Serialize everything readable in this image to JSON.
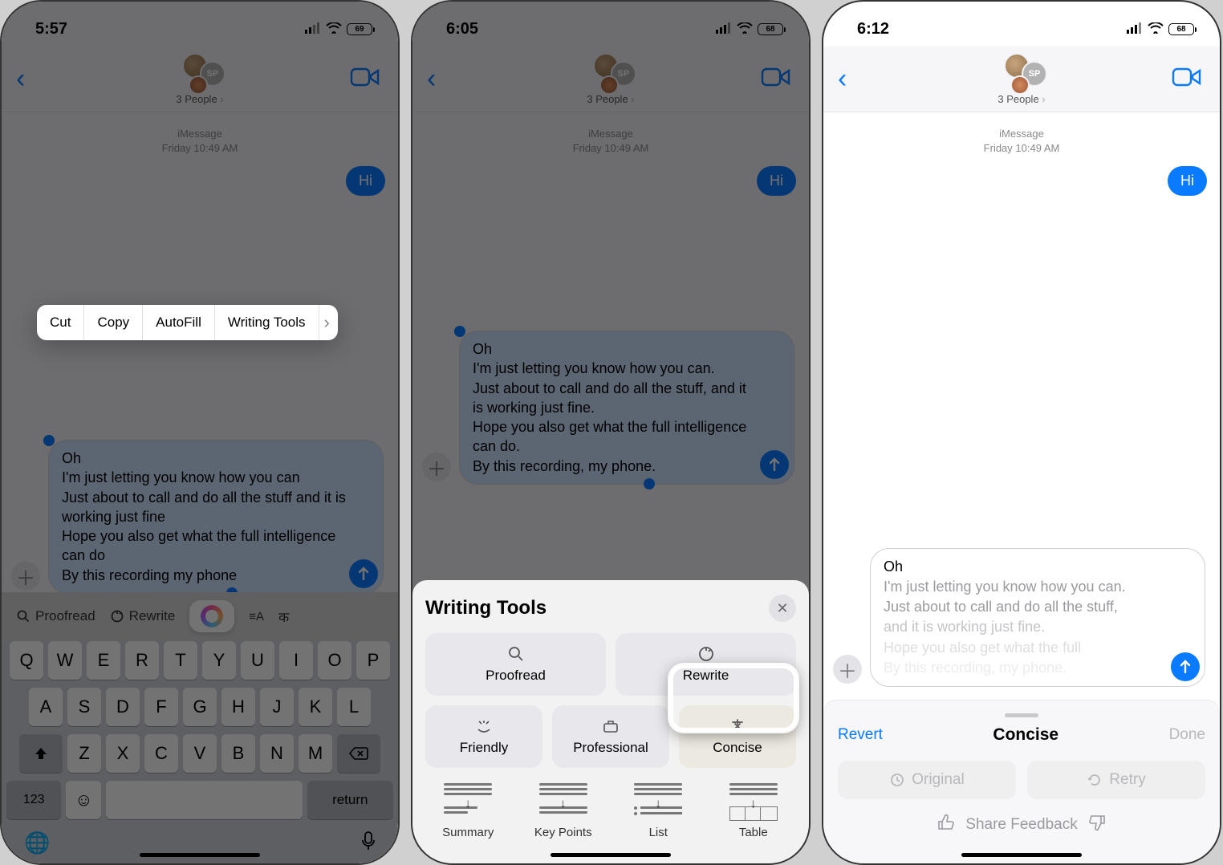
{
  "screens": [
    {
      "status": {
        "time": "5:57",
        "battery": "69"
      },
      "header": {
        "people_label": "3 People",
        "avatar_badge": "SP"
      },
      "thread": {
        "service": "iMessage",
        "timestamp": "Friday 10:49 AM",
        "out_msg": "Hi"
      },
      "compose_text": "Oh\nI'm just letting you know how you can\nJust about to call and do all the stuff and it is working just fine\nHope you also get what the full intelligence can do\nBy this recording my phone",
      "context_menu": {
        "cut": "Cut",
        "copy": "Copy",
        "autofill": "AutoFill",
        "writing_tools": "Writing Tools"
      },
      "quickrow": {
        "proofread": "Proofread",
        "rewrite": "Rewrite"
      },
      "keyboard": {
        "row1": [
          "Q",
          "W",
          "E",
          "R",
          "T",
          "Y",
          "U",
          "I",
          "O",
          "P"
        ],
        "row2": [
          "A",
          "S",
          "D",
          "F",
          "G",
          "H",
          "J",
          "K",
          "L"
        ],
        "row3": [
          "Z",
          "X",
          "C",
          "V",
          "B",
          "N",
          "M"
        ],
        "numkey": "123",
        "return": "return"
      }
    },
    {
      "status": {
        "time": "6:05",
        "battery": "68"
      },
      "header": {
        "people_label": "3 People",
        "avatar_badge": "SP"
      },
      "thread": {
        "service": "iMessage",
        "timestamp": "Friday 10:49 AM",
        "out_msg": "Hi"
      },
      "compose_text": "Oh\nI'm just letting you know how you can.\nJust about to call and do all the stuff, and it is working just fine.\nHope you also get what the full intelligence can do.\nBy this recording, my phone.",
      "wt_panel": {
        "title": "Writing Tools",
        "proofread": "Proofread",
        "rewrite": "Rewrite",
        "friendly": "Friendly",
        "professional": "Professional",
        "concise": "Concise",
        "summary": "Summary",
        "keypoints": "Key Points",
        "list": "List",
        "table": "Table"
      }
    },
    {
      "status": {
        "time": "6:12",
        "battery": "68"
      },
      "header": {
        "people_label": "3 People",
        "avatar_badge": "SP"
      },
      "thread": {
        "service": "iMessage",
        "timestamp": "Friday 10:49 AM",
        "out_msg": "Hi"
      },
      "compose_lines": {
        "l1": "Oh",
        "l2": "I'm just letting you know how you can.",
        "l3": "Just about to call and do all the stuff,",
        "l4": "and it is working just fine.",
        "l5": "Hope you also get what the full",
        "l6": "By this recording, my phone."
      },
      "concise_panel": {
        "revert": "Revert",
        "title": "Concise",
        "done": "Done",
        "original": "Original",
        "retry": "Retry",
        "feedback": "Share Feedback"
      }
    }
  ]
}
